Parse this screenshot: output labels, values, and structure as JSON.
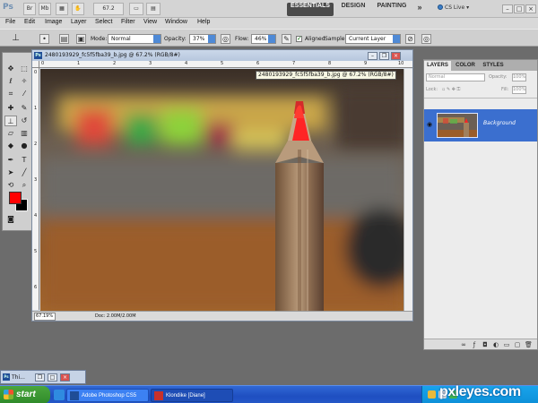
{
  "app": {
    "logo": "Ps",
    "zoom": "67.2",
    "workspaces": [
      "ESSENTIALS",
      "DESIGN",
      "PAINTING"
    ],
    "more": "»",
    "cs_live": "CS Live"
  },
  "menu": [
    "File",
    "Edit",
    "Image",
    "Layer",
    "Select",
    "Filter",
    "View",
    "Window",
    "Help"
  ],
  "options": {
    "mode_label": "Mode:",
    "mode_value": "Normal",
    "opacity_label": "Opacity:",
    "opacity_value": "37%",
    "flow_label": "Flow:",
    "flow_value": "46%",
    "aligned_label": "Aligned",
    "sample_label": "Sample:",
    "sample_value": "Current Layer"
  },
  "document": {
    "title": "2480193929_fc5f5fba39_b.jpg @ 67.2% (RGB/8#)",
    "zoom_readout": "67.19%",
    "doc_size": "Doc: 2.00M/2.00M",
    "tooltip": "2480193929_fc5f5fba39_b.jpg @ 67.2% (RGB/8#)",
    "ruler_top": [
      "0",
      "1",
      "2",
      "3",
      "4",
      "5",
      "6",
      "7",
      "8",
      "9",
      "10"
    ],
    "ruler_left": [
      "0",
      "1",
      "2",
      "3",
      "4",
      "5",
      "6"
    ]
  },
  "layers_panel": {
    "tabs": [
      "LAYERS",
      "COLOR",
      "STYLES"
    ],
    "blend_mode": "Normal",
    "opacity_label": "Opacity:",
    "opacity_value": "100%",
    "lock_label": "Lock:",
    "fill_label": "Fill:",
    "fill_value": "100%",
    "layer_name": "Background"
  },
  "minimized_doc": {
    "title": "Thi..."
  },
  "taskbar": {
    "start": "start",
    "tasks": [
      "Adobe Photoshop CS5",
      "Klondike [Diane]"
    ]
  },
  "watermark": "pxleyes.com",
  "colors": {
    "foreground": "#ff0000",
    "background": "#000000",
    "layer_selection": "#3b6fcf",
    "taskbar": "#245edb"
  }
}
